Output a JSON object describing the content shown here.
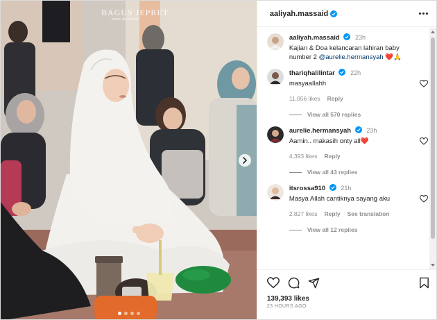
{
  "watermark": {
    "title": "BAGUS JEPRET",
    "subtitle": "photo & cinema"
  },
  "post": {
    "author": "aaliyah.massaid",
    "likes": "139,393 likes",
    "date": "23 HOURS AGO",
    "slide_count": 4,
    "active_slide": 1
  },
  "caption": {
    "user": "aaliyah.massaid",
    "time": "23h",
    "text_before": "Kajian & Doa kelancaran lahiran baby number 2 ",
    "mention": "@aurelie.hermansyah",
    "text_after": " ❤️🙏"
  },
  "comments": [
    {
      "user": "thariqhalilintar",
      "verified": true,
      "time": "22h",
      "text": "masyaallahh",
      "likes": "11,056 likes",
      "reply_label": "Reply",
      "see_translation": "",
      "view_replies": "View all 570 replies"
    },
    {
      "user": "aurelie.hermansyah",
      "verified": true,
      "time": "23h",
      "text": "Aamin.. makasih onty all❤️",
      "likes": "4,393 likes",
      "reply_label": "Reply",
      "see_translation": "",
      "view_replies": "View all 43 replies"
    },
    {
      "user": "itsrossa910",
      "verified": true,
      "time": "21h",
      "text": "Masya Allah cantiknya sayang aku",
      "likes": "2,827 likes",
      "reply_label": "Reply",
      "see_translation": "See translation",
      "view_replies": "View all 12 replies"
    }
  ],
  "colors": {
    "verified": "#0095f6",
    "accent_text": "#00376b",
    "muted": "#8e8e8e"
  },
  "icons": [
    "more-icon",
    "heart-icon",
    "comment-icon",
    "share-icon",
    "bookmark-icon",
    "next-arrow-icon",
    "verified-badge-icon"
  ]
}
